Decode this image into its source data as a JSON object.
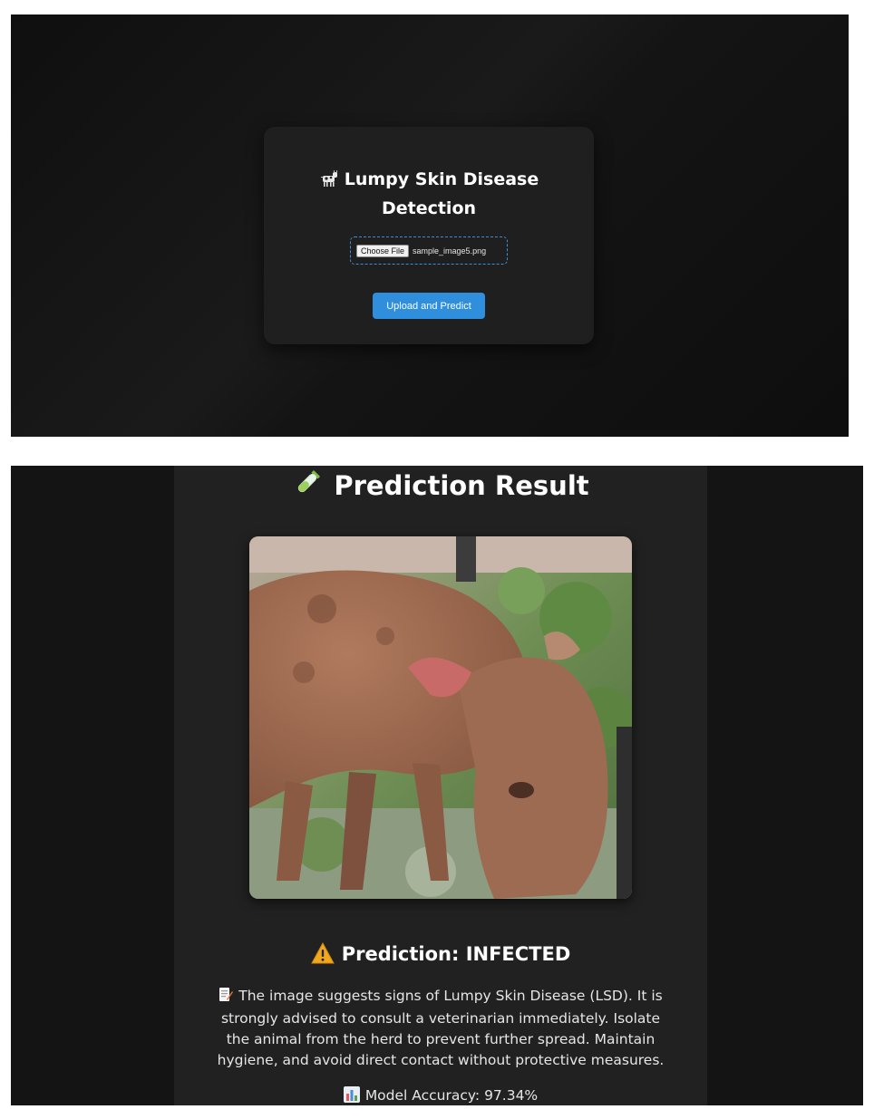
{
  "upload_screen": {
    "title": "Lumpy Skin Disease Detection",
    "title_icon": "cow-icon",
    "file_input": {
      "button_label": "Choose File",
      "selected_file": "sample_image5.png"
    },
    "submit_label": "Upload and Predict",
    "colors": {
      "accent": "#2f8fdd",
      "card": "#1f1f1f",
      "background": "#141414"
    }
  },
  "result_screen": {
    "heading": "Prediction Result",
    "heading_icon": "test-tube-icon",
    "image_alt": "uploaded cattle image",
    "prediction": "Prediction: INFECTED",
    "prediction_icon": "warning-icon",
    "advice": "The image suggests signs of Lumpy Skin Disease (LSD). It is strongly advised to consult a veterinarian immediately. Isolate the animal from the herd to prevent further spread. Maintain hygiene, and avoid direct contact without protective measures.",
    "advice_icon": "memo-icon",
    "accuracy": "Model Accuracy: 97.34%",
    "accuracy_icon": "bar-chart-icon"
  }
}
